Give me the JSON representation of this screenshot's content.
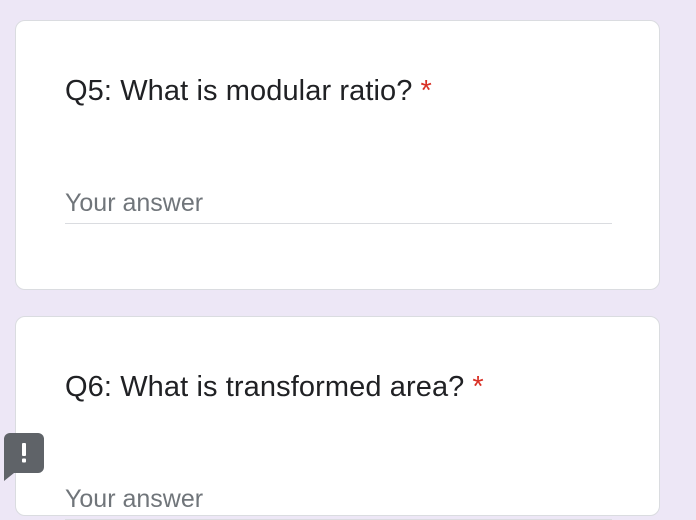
{
  "questions": [
    {
      "title": "Q5: What is modular ratio?",
      "required_marker": "*",
      "answer_placeholder": "Your answer",
      "answer_value": ""
    },
    {
      "title": "Q6: What is transformed area?",
      "required_marker": "*",
      "answer_placeholder": "Your answer",
      "answer_value": ""
    }
  ],
  "feedback": {
    "icon": "report-problem-icon"
  },
  "colors": {
    "page_background": "#ede7f6",
    "card_background": "#ffffff",
    "required": "#d93025",
    "feedback_button": "#5f6368"
  }
}
